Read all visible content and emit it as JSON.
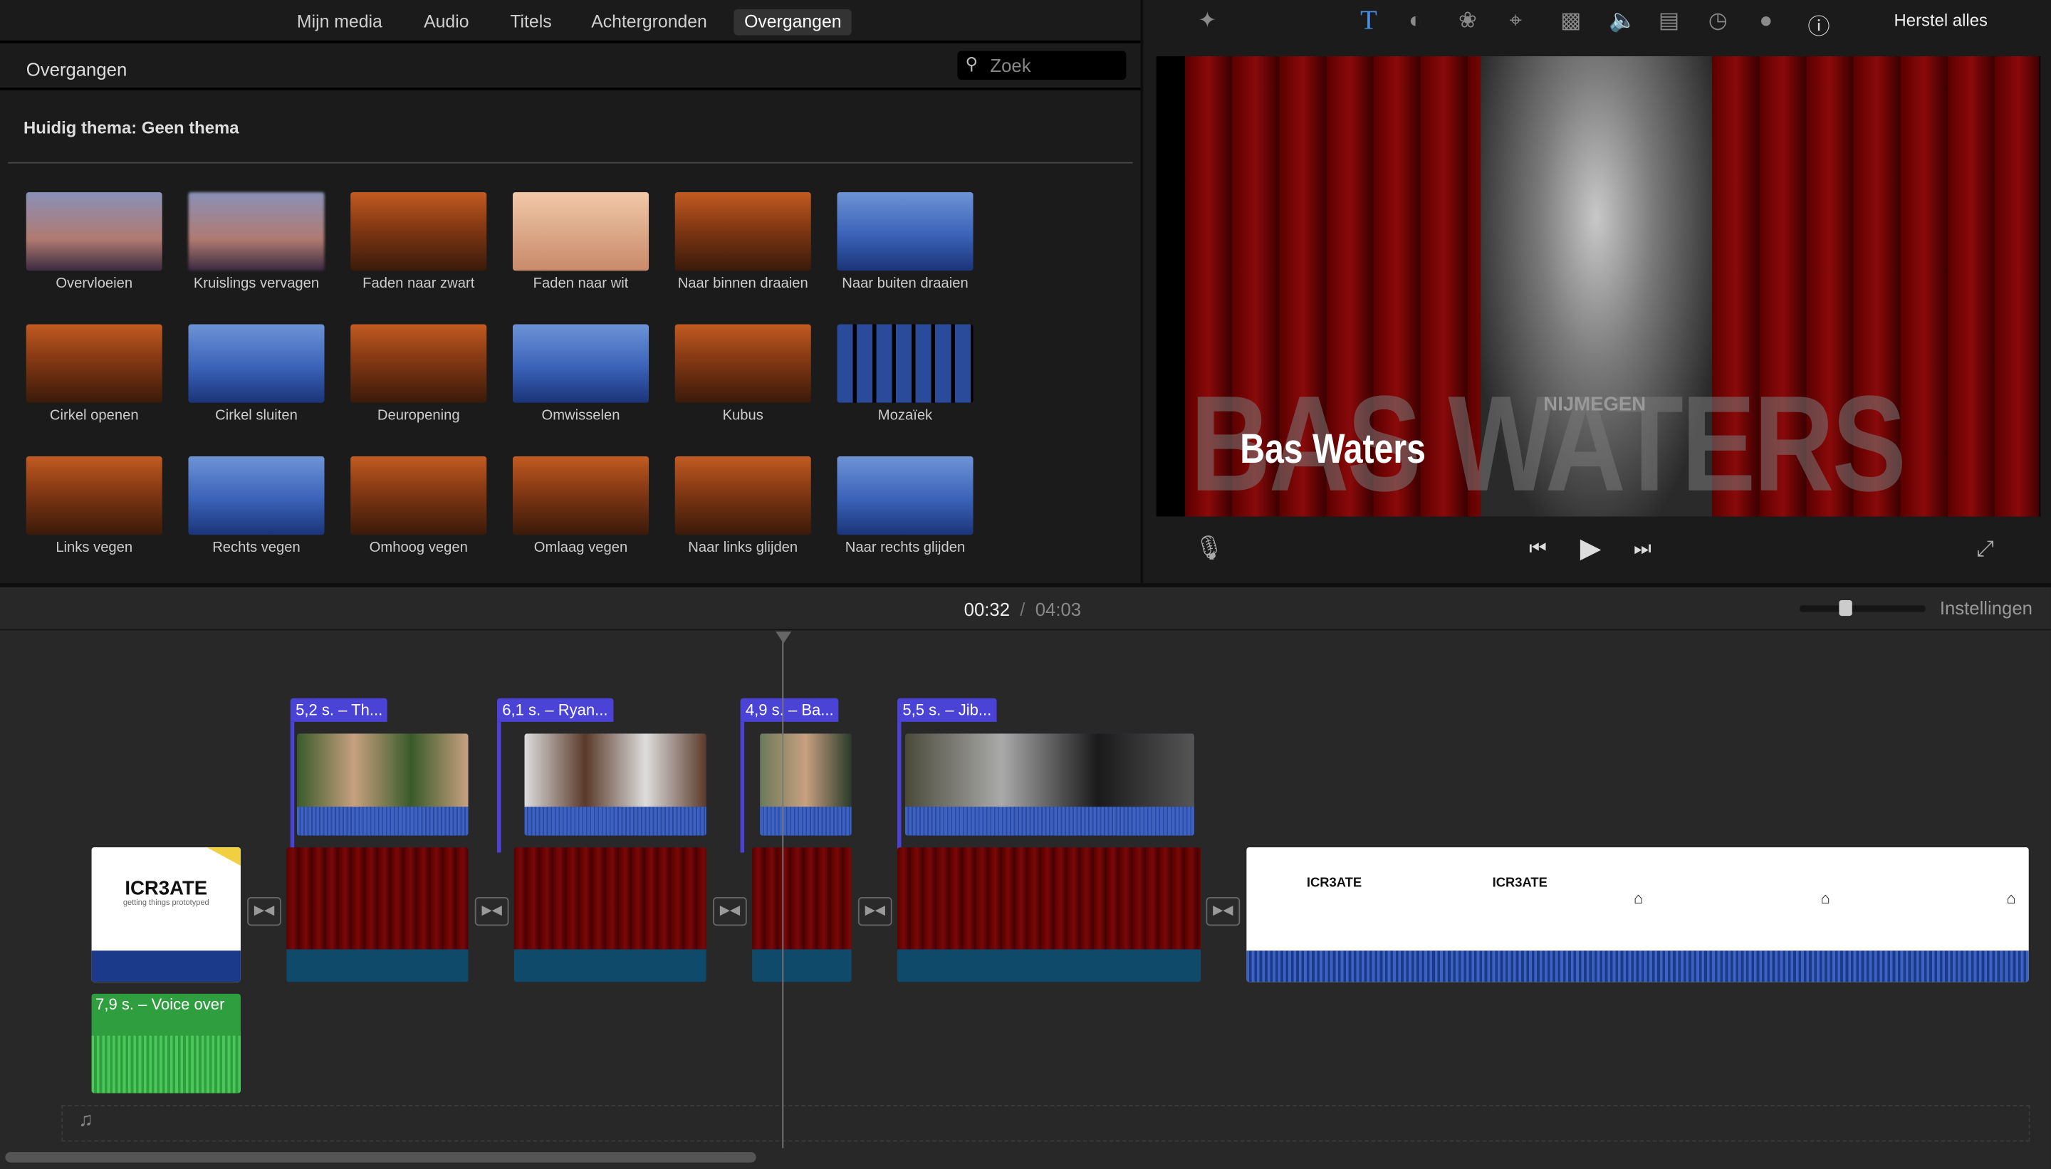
{
  "tabs": [
    "Mijn media",
    "Audio",
    "Titels",
    "Achtergronden",
    "Overgangen"
  ],
  "active_tab": "Overgangen",
  "browser": {
    "title": "Overgangen",
    "search_placeholder": "Zoek",
    "theme_label": "Huidig thema: Geen thema"
  },
  "transitions": [
    "Overvloeien",
    "Kruislings vervagen",
    "Faden naar zwart",
    "Faden naar wit",
    "Naar binnen draaien",
    "Naar buiten draaien",
    "Cirkel openen",
    "Cirkel sluiten",
    "Deuropening",
    "Omwisselen",
    "Kubus",
    "Mozaïek",
    "Links vegen",
    "Rechts vegen",
    "Omhoog vegen",
    "Omlaag vegen",
    "Naar links glijden",
    "Naar rechts glijden"
  ],
  "toolbar": {
    "reset_label": "Herstel alles",
    "icons": [
      "magic-wand",
      "title",
      "color-balance",
      "color-correction",
      "crop",
      "stabilization",
      "volume",
      "equalizer",
      "speed",
      "filter",
      "info"
    ]
  },
  "viewer": {
    "title_text": "Bas Waters",
    "background_text": "BAS WATERS",
    "shirt_text": "NIJMEGEN"
  },
  "timeline": {
    "current_time": "00:32",
    "total_time": "04:03",
    "settings_label": "Instellingen",
    "clips": [
      "5,2 s. – Th...",
      "6,1 s. – Ryan...",
      "4,9 s. – Ba...",
      "5,5 s. – Jib..."
    ],
    "voiceover": "7,9 s. – Voice over",
    "logo_text": "ICR3ATE",
    "logo_tagline": "getting things prototyped"
  },
  "colors": {
    "accent": "#4a90e2",
    "clip_label": "#4a43d6",
    "voiceover": "#2e9e3e",
    "curtain": "#6a0404"
  }
}
